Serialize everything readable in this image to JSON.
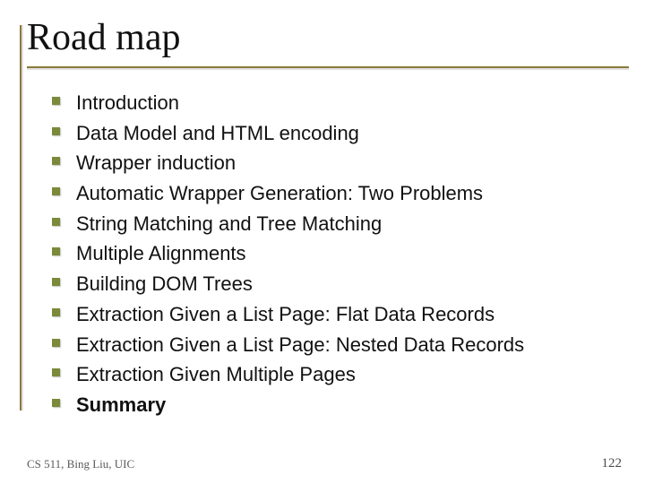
{
  "title": "Road map",
  "items": [
    {
      "text": "Introduction",
      "bold": false
    },
    {
      "text": "Data Model and HTML encoding",
      "bold": false
    },
    {
      "text": "Wrapper induction",
      "bold": false
    },
    {
      "text": "Automatic Wrapper Generation: Two Problems",
      "bold": false
    },
    {
      "text": "String Matching and Tree Matching",
      "bold": false
    },
    {
      "text": "Multiple Alignments",
      "bold": false
    },
    {
      "text": "Building DOM Trees",
      "bold": false
    },
    {
      "text": "Extraction Given a List Page: Flat Data Records",
      "bold": false
    },
    {
      "text": "Extraction Given a List Page: Nested Data Records",
      "bold": false
    },
    {
      "text": "Extraction Given Multiple Pages",
      "bold": false
    },
    {
      "text": "Summary",
      "bold": true
    }
  ],
  "footer": "CS 511, Bing Liu, UIC",
  "page_number": "122"
}
